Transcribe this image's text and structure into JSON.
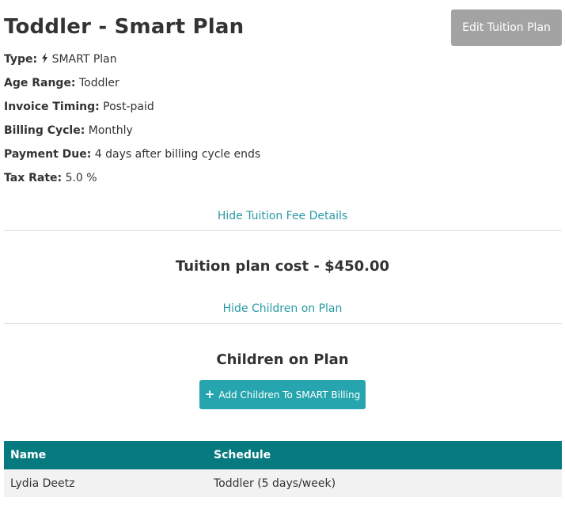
{
  "header": {
    "title": "Toddler - Smart Plan",
    "edit_label": "Edit Tuition Plan"
  },
  "details": [
    {
      "label": "Type:",
      "value": "SMART Plan",
      "icon": "bolt-icon"
    },
    {
      "label": "Age Range:",
      "value": "Toddler"
    },
    {
      "label": "Invoice Timing:",
      "value": "Post-paid"
    },
    {
      "label": "Billing Cycle:",
      "value": "Monthly"
    },
    {
      "label": "Payment Due:",
      "value": "4 days after billing cycle ends"
    },
    {
      "label": "Tax Rate:",
      "value": "5.0 %"
    }
  ],
  "links": {
    "hide_fee_details": "Hide Tuition Fee Details",
    "hide_children": "Hide Children on Plan"
  },
  "cost": {
    "text": "Tuition plan cost - $450.00"
  },
  "children": {
    "title": "Children on Plan",
    "add_label": "Add Children To SMART Billing",
    "columns": [
      "Name",
      "Schedule"
    ],
    "rows": [
      {
        "name": "Lydia Deetz",
        "schedule": "Toddler (5 days/week)"
      }
    ]
  },
  "colors": {
    "accent": "#26a5ae",
    "link": "#2a9aa6",
    "table_header": "#077a80",
    "edit_button": "#a3a3a3"
  }
}
